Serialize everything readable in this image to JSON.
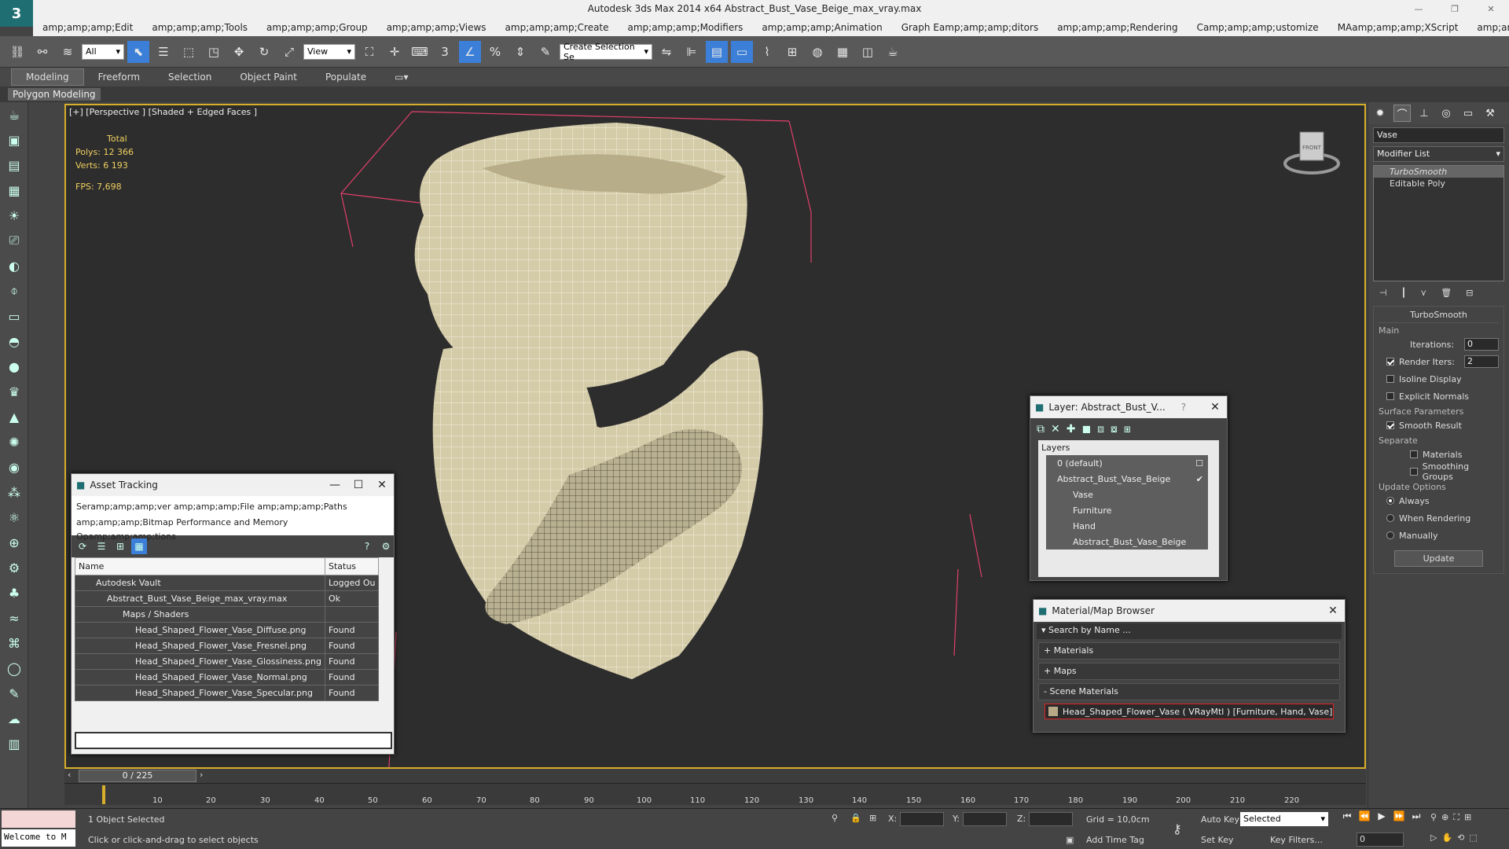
{
  "window": {
    "title": "Autodesk 3ds Max  2014 x64    Abstract_Bust_Vase_Beige_max_vray.max",
    "logo": "3"
  },
  "menu": [
    "amp;amp;amp;Edit",
    "amp;amp;amp;Tools",
    "amp;amp;amp;Group",
    "amp;amp;amp;Views",
    "amp;amp;amp;Create",
    "amp;amp;amp;Modifiers",
    "amp;amp;amp;Animation",
    "Graph Eamp;amp;amp;ditors",
    "amp;amp;amp;Rendering",
    "Camp;amp;amp;ustomize",
    "MAamp;amp;amp;XScript",
    "amp;amp;amp;Help"
  ],
  "toolbar": {
    "filter_value": "All",
    "refcoord_value": "View",
    "selection_set": "Create Selection Se"
  },
  "ribbon": {
    "tabs": [
      "Modeling",
      "Freeform",
      "Selection",
      "Object Paint",
      "Populate"
    ],
    "panel": "Polygon Modeling"
  },
  "viewport": {
    "label": "[+] [Perspective ] [Shaded + Edged Faces ]",
    "stats_header": "Total",
    "polys_label": "Polys:",
    "polys_value": "12 366",
    "verts_label": "Verts:",
    "verts_value": "6 193",
    "fps_label": "FPS:",
    "fps_value": "7,698",
    "viewcube_label": "FRONT"
  },
  "command_panel": {
    "object_name": "Vase",
    "modifier_list": "Modifier List",
    "stack": [
      "TurboSmooth",
      "Editable Poly"
    ],
    "rollout_title": "TurboSmooth",
    "main_group": "Main",
    "iterations_label": "Iterations:",
    "iterations_value": "0",
    "render_iters_label": "Render Iters:",
    "render_iters_value": "2",
    "isoline_label": "Isoline Display",
    "explicit_label": "Explicit Normals",
    "surface_group": "Surface Parameters",
    "smooth_result": "Smooth Result",
    "separate_group": "Separate",
    "materials_label": "Materials",
    "smoothing_groups_label": "Smoothing Groups",
    "update_group": "Update Options",
    "always_label": "Always",
    "when_rendering_label": "When Rendering",
    "manually_label": "Manually",
    "update_button": "Update"
  },
  "asset_tracking": {
    "title": "Asset Tracking",
    "menu_line1": "Seramp;amp;amp;ver     amp;amp;amp;File     amp;amp;amp;Paths",
    "menu_line2": "amp;amp;amp;Bitmap Performance and Memory",
    "menu_line3": "Opamp;amp;amp;tions",
    "col_name": "Name",
    "col_status": "Status",
    "rows": [
      {
        "name": "Autodesk Vault",
        "status": "Logged Ou"
      },
      {
        "name": "Abstract_Bust_Vase_Beige_max_vray.max",
        "status": "Ok"
      },
      {
        "name": "Maps / Shaders",
        "status": ""
      },
      {
        "name": "Head_Shaped_Flower_Vase_Diffuse.png",
        "status": "Found"
      },
      {
        "name": "Head_Shaped_Flower_Vase_Fresnel.png",
        "status": "Found"
      },
      {
        "name": "Head_Shaped_Flower_Vase_Glossiness.png",
        "status": "Found"
      },
      {
        "name": "Head_Shaped_Flower_Vase_Normal.png",
        "status": "Found"
      },
      {
        "name": "Head_Shaped_Flower_Vase_Specular.png",
        "status": "Found"
      }
    ]
  },
  "layer_window": {
    "title": "Layer: Abstract_Bust_V...",
    "help": "?",
    "header": "Layers",
    "items": [
      "0 (default)",
      "Abstract_Bust_Vase_Beige",
      "Vase",
      "Furniture",
      "Hand",
      "Abstract_Bust_Vase_Beige"
    ]
  },
  "material_browser": {
    "title": "Material/Map Browser",
    "search_placeholder": "Search by Name ...",
    "sections": [
      "+ Materials",
      "+ Maps",
      "- Scene Materials"
    ],
    "item": "Head_Shaped_Flower_Vase  ( VRayMtl ) [Furniture, Hand, Vase]"
  },
  "timeline": {
    "frame": "0 / 225",
    "ticks": [
      "10",
      "20",
      "30",
      "40",
      "50",
      "60",
      "70",
      "80",
      "90",
      "100",
      "110",
      "120",
      "130",
      "140",
      "150",
      "160",
      "170",
      "180",
      "190",
      "200",
      "210",
      "220"
    ]
  },
  "status": {
    "welcome": "Welcome to M",
    "selected": "1 Object Selected",
    "prompt": "Click or click-and-drag to select objects",
    "x_label": "X:",
    "y_label": "Y:",
    "z_label": "Z:",
    "grid": "Grid = 10,0cm",
    "auto_key": "Auto Key",
    "set_key": "Set Key",
    "selected_dropdown": "Selected",
    "key_filters": "Key Filters...",
    "add_time_tag": "Add Time Tag",
    "frame_field": "0"
  },
  "colors": {
    "accent": "#3b7fd8",
    "viewport_border": "#d7ae2b",
    "mesh": "#d8d0b0",
    "bbox": "#e0406a"
  }
}
